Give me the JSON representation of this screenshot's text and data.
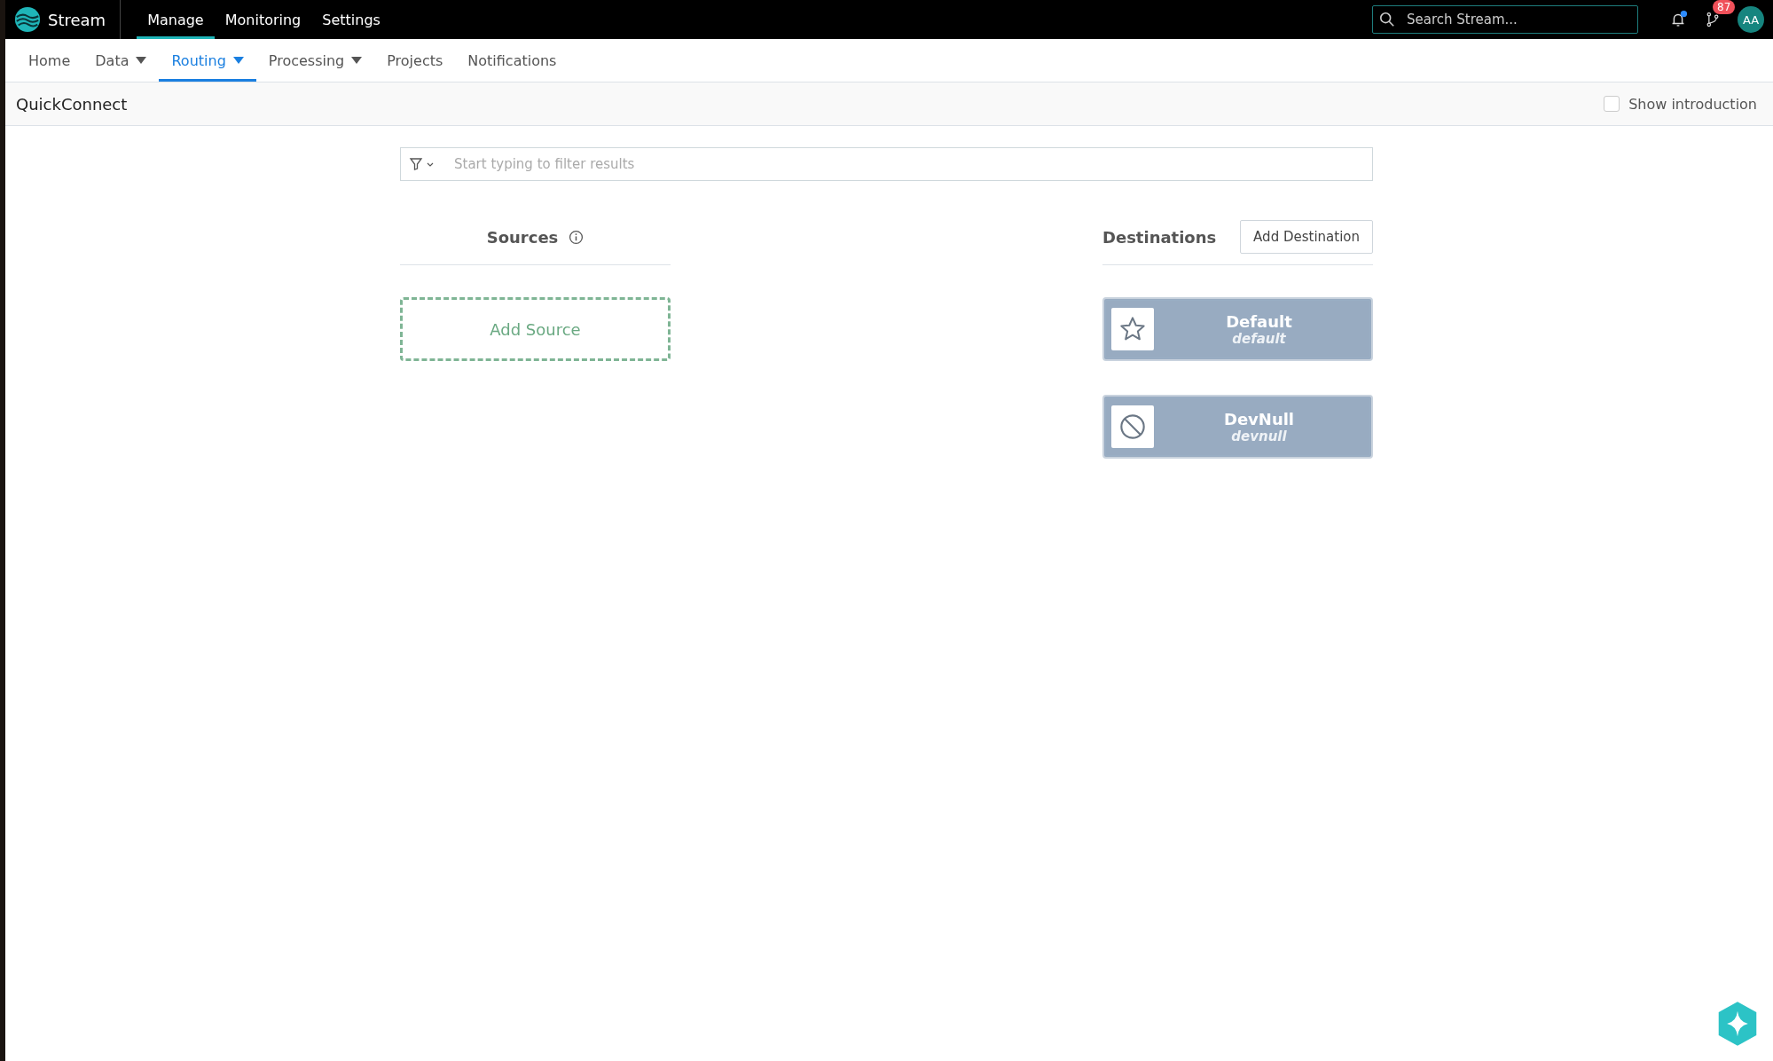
{
  "top_bar": {
    "brand": "Stream",
    "nav": [
      {
        "label": "Manage",
        "selected": true
      },
      {
        "label": "Monitoring",
        "selected": false
      },
      {
        "label": "Settings",
        "selected": false
      }
    ],
    "search": {
      "placeholder": "Search Stream..."
    },
    "branch_badge": "87",
    "avatar": "AA"
  },
  "tabs": [
    {
      "label": "Home",
      "selected": false,
      "dropdown": false
    },
    {
      "label": "Data",
      "selected": false,
      "dropdown": true
    },
    {
      "label": "Routing",
      "selected": true,
      "dropdown": true
    },
    {
      "label": "Processing",
      "selected": false,
      "dropdown": true
    },
    {
      "label": "Projects",
      "selected": false,
      "dropdown": false
    },
    {
      "label": "Notifications",
      "selected": false,
      "dropdown": false
    }
  ],
  "page": {
    "title": "QuickConnect",
    "show_introduction": {
      "label": "Show introduction",
      "checked": false
    }
  },
  "filter": {
    "placeholder": "Start typing to filter results"
  },
  "sources": {
    "heading": "Sources",
    "add_label": "Add Source"
  },
  "destinations": {
    "heading": "Destinations",
    "add_button": "Add Destination",
    "items": [
      {
        "kind": "star",
        "name": "Default",
        "id": "default"
      },
      {
        "kind": "blocked",
        "name": "DevNull",
        "id": "devnull"
      }
    ]
  }
}
